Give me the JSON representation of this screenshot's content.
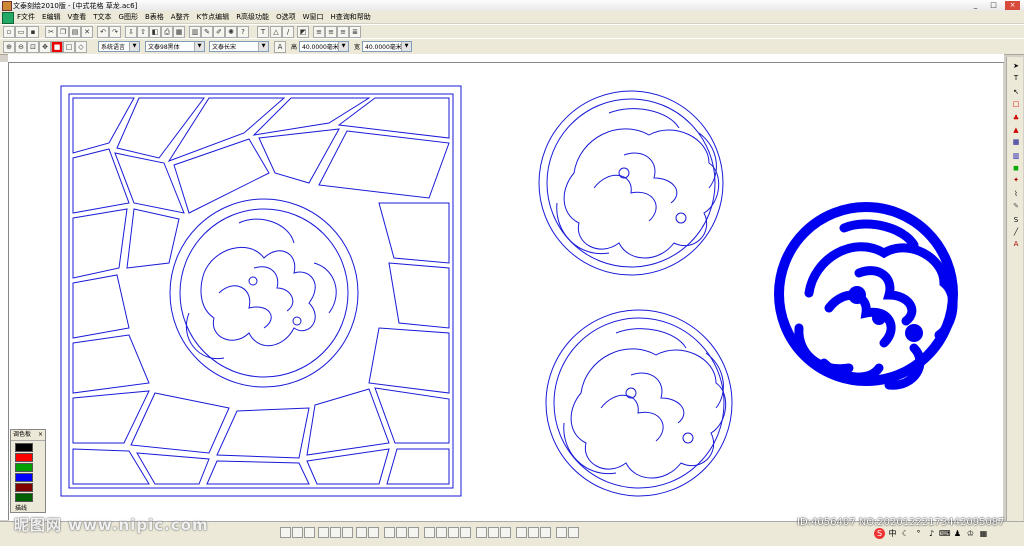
{
  "window": {
    "title": "文泰刻绘2010版 - [中式花格 草龙.ac6]",
    "minimize": "_",
    "maximize": "□",
    "close": "×"
  },
  "menu": [
    {
      "label": "F文件"
    },
    {
      "label": "E编辑"
    },
    {
      "label": "V查看"
    },
    {
      "label": "T文本"
    },
    {
      "label": "G图形"
    },
    {
      "label": "B表格"
    },
    {
      "label": "A整齐"
    },
    {
      "label": "K节点编辑"
    },
    {
      "label": "R高级功能"
    },
    {
      "label": "O选项"
    },
    {
      "label": "W窗口"
    },
    {
      "label": "H查询和帮助"
    }
  ],
  "mdi": {
    "minimize": "-",
    "restore": "▫",
    "close": "×"
  },
  "toolbar2": {
    "lang_select": "系统语言",
    "font_select": "文泰98黑体",
    "font_select2": "文泰长宋",
    "height_label": "高",
    "height_value": "40.0000毫米",
    "width_label": "宽",
    "width_value": "40.0000毫米"
  },
  "palette": {
    "title": "调色板",
    "close": "×",
    "colors": [
      "#000000",
      "#ff0000",
      "#00a000",
      "#0000ff",
      "#800000",
      "#006000"
    ],
    "footer": "描线"
  },
  "watermark": {
    "text": "昵图网 www.nipic.com"
  },
  "image_id": "ID:4056407 NO:20201222173442095087",
  "theme": {
    "stroke": "#1a1ad8",
    "fill": "#0000f0"
  }
}
